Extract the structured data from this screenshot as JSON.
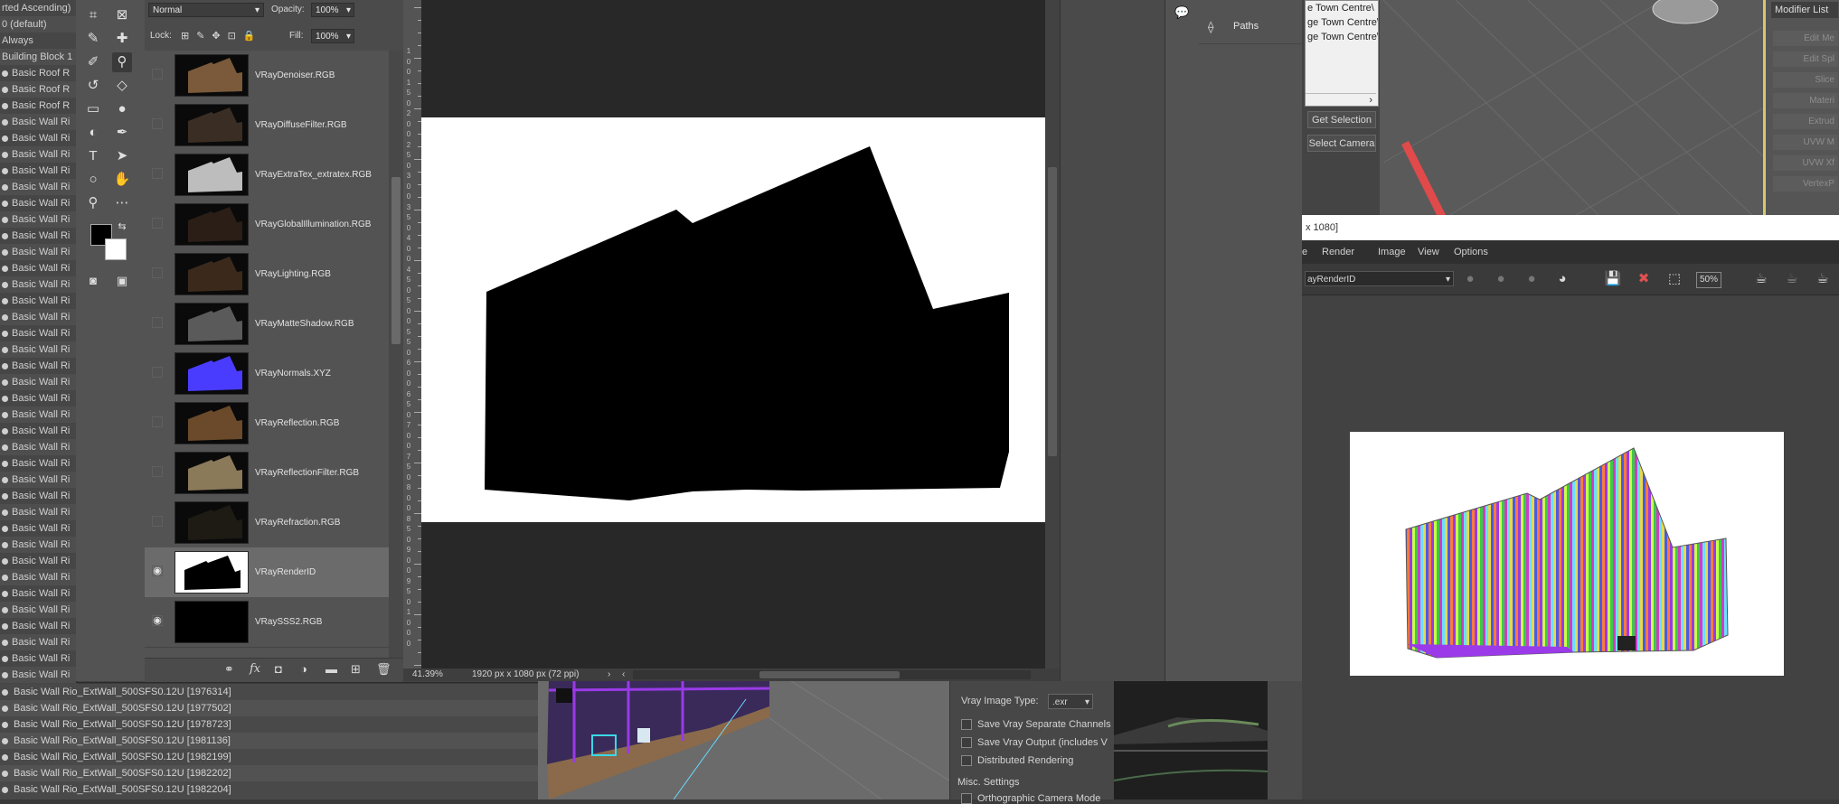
{
  "scene_explorer": {
    "rows": [
      "rted Ascending)",
      "0 (default)",
      "Always",
      "Building Block 1",
      "Basic Roof R",
      "Basic Roof R",
      "Basic Roof R",
      "Basic Wall Ri",
      "Basic Wall Ri",
      "Basic Wall Ri",
      "Basic Wall Ri",
      "Basic Wall Ri",
      "Basic Wall Ri",
      "Basic Wall Ri",
      "Basic Wall Ri",
      "Basic Wall Ri",
      "Basic Wall Ri",
      "Basic Wall Ri",
      "Basic Wall Ri",
      "Basic Wall Ri",
      "Basic Wall Ri",
      "Basic Wall Ri",
      "Basic Wall Ri",
      "Basic Wall Ri",
      "Basic Wall Ri",
      "Basic Wall Ri",
      "Basic Wall Ri",
      "Basic Wall Ri",
      "Basic Wall Ri",
      "Basic Wall Ri",
      "Basic Wall Ri",
      "Basic Wall Ri",
      "Basic Wall Ri",
      "Basic Wall Ri",
      "Basic Wall Ri",
      "Basic Wall Ri",
      "Basic Wall Ri",
      "Basic Wall Ri",
      "Basic Wall Ri",
      "Basic Wall Ri",
      "Basic Wall Ri",
      "Basic Wall Ri"
    ],
    "bottom_rows": [
      "Basic Wall Rio_ExtWall_500SFS0.12U [1976314]",
      "Basic Wall Rio_ExtWall_500SFS0.12U [1977502]",
      "Basic Wall Rio_ExtWall_500SFS0.12U [1978723]",
      "Basic Wall Rio_ExtWall_500SFS0.12U [1981136]",
      "Basic Wall Rio_ExtWall_500SFS0.12U [1982199]",
      "Basic Wall Rio_ExtWall_500SFS0.12U [1982202]",
      "Basic Wall Rio_ExtWall_500SFS0.12U [1982204]"
    ]
  },
  "layers_panel": {
    "blend_mode": "Normal",
    "opacity_label": "Opacity:",
    "opacity_value": "100%",
    "lock_label": "Lock:",
    "fill_label": "Fill:",
    "fill_value": "100%",
    "layers": [
      {
        "name": "VRayDenoiser.RGB",
        "visible": false,
        "thumb": "#7a5a3a"
      },
      {
        "name": "VRayDiffuseFilter.RGB",
        "visible": false,
        "thumb": "#3a2e24"
      },
      {
        "name": "VRayExtraTex_extratex.RGB",
        "visible": false,
        "thumb": "#bdbdbd"
      },
      {
        "name": "VRayGlobalIllumination.RGB",
        "visible": false,
        "thumb": "#2a1e16"
      },
      {
        "name": "VRayLighting.RGB",
        "visible": false,
        "thumb": "#3b2a1c"
      },
      {
        "name": "VRayMatteShadow.RGB",
        "visible": false,
        "thumb": "#5a5a5a"
      },
      {
        "name": "VRayNormals.XYZ",
        "visible": false,
        "thumb": "#4a3cff"
      },
      {
        "name": "VRayReflection.RGB",
        "visible": false,
        "thumb": "#6a4a2a"
      },
      {
        "name": "VRayReflectionFilter.RGB",
        "visible": false,
        "thumb": "#8a7a5a"
      },
      {
        "name": "VRayRefraction.RGB",
        "visible": false,
        "thumb": "#1e1a14"
      },
      {
        "name": "VRayRenderID",
        "visible": true,
        "thumb": "#ffffff",
        "selected": true
      },
      {
        "name": "VRaySSS2.RGB",
        "visible": true,
        "thumb": "#000000"
      }
    ]
  },
  "ruler_labels": [
    "1",
    "0",
    "0",
    "1",
    "5",
    "0",
    "2",
    "0",
    "0",
    "2",
    "5",
    "0",
    "3",
    "0",
    "0",
    "3",
    "5",
    "0",
    "4",
    "0",
    "0",
    "4",
    "5",
    "0",
    "5",
    "0",
    "0",
    "5",
    "5",
    "0",
    "6",
    "0",
    "0",
    "6",
    "5",
    "0",
    "7",
    "0",
    "0",
    "7",
    "5",
    "0",
    "8",
    "0",
    "0",
    "8",
    "5",
    "0",
    "9",
    "0",
    "0",
    "9",
    "5",
    "0",
    "1",
    "0",
    "0",
    "0"
  ],
  "status": {
    "zoom": "41.39%",
    "doc_info": "1920 px x 1080 px (72 ppi)"
  },
  "paths_panel": {
    "tab": "Paths"
  },
  "max_list": {
    "items": [
      "e Town Centre\\",
      "ge Town Centre\\",
      "ge Town Centre\\"
    ]
  },
  "max_buttons": {
    "get_selection": "Get Selection",
    "select_camera": "Select Camera"
  },
  "modifier_panel": {
    "title": "Modifier List",
    "items": [
      "Edit Me",
      "Edit Spl",
      "Slice",
      "Materi",
      "Extrud",
      "UVW M",
      "UVW Xf",
      "VertexP"
    ]
  },
  "vfb": {
    "title": "x 1080]",
    "menu": [
      "e",
      "Render",
      "Image",
      "View",
      "Options"
    ],
    "channel": "ayRenderID",
    "zoom_readout": "50%"
  },
  "render_settings": {
    "image_type_label": "Vray Image Type:",
    "image_type_value": ".exr",
    "options": [
      "Save Vray Separate Channels",
      "Save Vray Output (includes V",
      "Distributed Rendering"
    ],
    "misc_label": "Misc. Settings",
    "misc_option": "Orthographic Camera Mode"
  }
}
